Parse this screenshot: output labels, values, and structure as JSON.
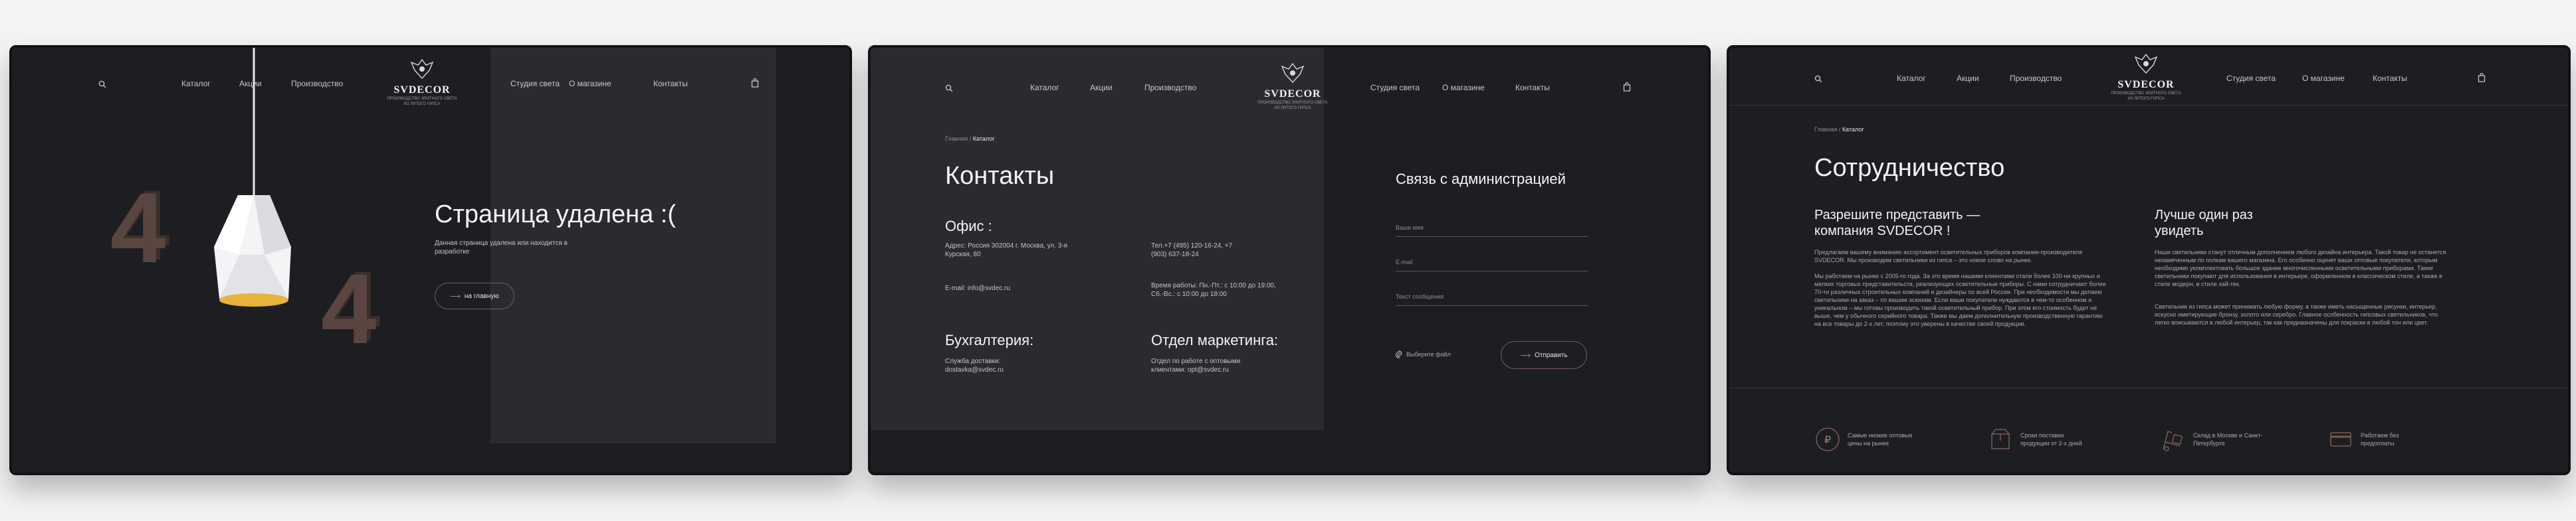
{
  "nav": {
    "catalog": "Каталог",
    "sales": "Акции",
    "production": "Производство",
    "studio": "Студия света",
    "about": "О магазине",
    "contacts": "Контакты"
  },
  "logo": {
    "name": "SVDECOR",
    "tagline1": "ПРОИЗВОДСТВО ЭЛИТНОГО СВЕТА",
    "tagline2": "ИЗ ЛИТОГО ГИПСА"
  },
  "page404": {
    "title": "Страница удалена :(",
    "description": "Данная страница удалена или находится в разработке",
    "home_button": "на главную",
    "digit": "4"
  },
  "contacts": {
    "breadcrumb_home": "Главная",
    "breadcrumb_sep": "/",
    "breadcrumb_current": "Каталог",
    "title": "Контакты",
    "office_heading": "Офис :",
    "address": "Адрес: Россия 302004 г. Москва, ул. 3-я Курская, 80",
    "phones": "Тел.+7 (495) 120-16-24, +7 (903) 637-18-24",
    "email": "E-mail: info@svdec.ru",
    "hours": "Время работы: Пн.-Пт.: с 10:00 до 19:00, Сб.-Вс.: с 10:00 до 18:00",
    "accounting_heading": "Бухгалтерия:",
    "accounting_text1": "Служба доставки:",
    "accounting_text2": "dostavka@svdec.ru",
    "marketing_heading": "Отдел маркетинга:",
    "marketing_text1": "Отдел по работе с оптовыми",
    "marketing_text2": "клиентами: opt@svdec.ru",
    "form_heading": "Связь с администрацией",
    "name_placeholder": "Ваше имя",
    "email_placeholder": "E-mail",
    "message_placeholder": "Текст сообщения",
    "attach_label": "Выберите файл",
    "submit_label": "Отправить"
  },
  "cooperation": {
    "breadcrumb_home": "Главная",
    "breadcrumb_sep": "/",
    "breadcrumb_current": "Каталог",
    "title": "Сотрудничество",
    "left_heading": "Разрешите представить — компания SVDECOR !",
    "left_p1": "Предлагаем вашему вниманию ассортимент осветительных приборов компании-производителя SVDECOR. Мы производим светильники из гипса – это новое слово на рынке.",
    "left_p2": "Мы работаем на рынке с 2005-го года. За это время нашими клиентами стали более 100-ни крупных и мелких торговых представительств, реализующих осветительные приборы. С нами сотрудничают более 70-ти различных строительных компаний и дизайнеры по всей России. При необходимости мы делаем светильники на заказ – по вашим эскизам. Если ваши покупатели нуждаются в чем-то особенном и уникальном – мы готовы производить такой осветительный прибор. При этом его стоимость будет не выше, чем у обычного серийного товара. Также мы даем дополнительную производственную гарантию на все товары до 2-х лет, поэтому это уверены в качестве своей продукции.",
    "right_heading": "Лучше один раз увидеть",
    "right_p1": "Наши светильники станут отличным дополнением любого дизайна интерьера. Такой товар не останется незамеченным по полкам вашего магазина. Его особенно оценят ваши оптовые покупатели, которым необходимо укомплектовать большое здание многочисленными осветительными приборами. Такие светильники покупают для использования в интерьере, оформленном в классическом стиле, а также в стиле модерн, в стиле хай-тек.",
    "right_p2": "Светильник из гипса может принимать любую форму, а также иметь насыщенные рисунки, интерьер, искусно имитирующие бронзу, золото или серебро. Главное особенность гипсовых светильников, что легко вписываются в любой интерьер, так как предназначены для покраски в любой тон или цвет.",
    "features": [
      {
        "icon": "price-icon",
        "text": "Самые низкие оптовые цены на рынке"
      },
      {
        "icon": "box-icon",
        "text": "Сроки поставки продукции от 2-х дней"
      },
      {
        "icon": "warehouse-icon",
        "text": "Склад в Москве и Санкт-Петербурге"
      },
      {
        "icon": "card-icon",
        "text": "Работаем без предоплаты"
      }
    ]
  },
  "colors": {
    "background": "#1d1e22",
    "panel_alt": "#2a2b30",
    "accent": "#7a5b52",
    "lamp_glow": "#e8b33b"
  }
}
